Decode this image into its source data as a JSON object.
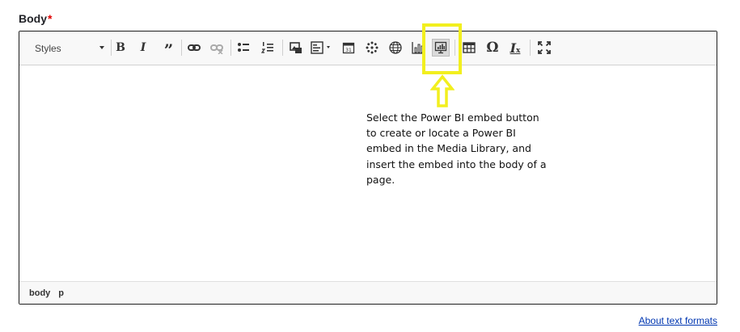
{
  "field": {
    "label": "Body",
    "required_marker": "*"
  },
  "toolbar": {
    "styles_label": "Styles",
    "bold_label": "B",
    "italic_label": "I",
    "quote_label": "”",
    "special_char_label": "Ω",
    "remove_format_label": "I",
    "icons": [
      "bold-icon",
      "italic-icon",
      "blockquote-icon",
      "link-icon",
      "unlink-icon",
      "bulleted-list-icon",
      "numbered-list-icon",
      "image-icon",
      "align-icon",
      "calendar-icon",
      "spark-icon",
      "globe-icon",
      "chart-icon",
      "power-bi-embed-icon",
      "table-icon",
      "special-character-icon",
      "remove-format-icon",
      "maximize-icon"
    ]
  },
  "annotation": {
    "lines": [
      "Select the Power BI embed button",
      "to create or locate a Power BI",
      "embed in the Media Library, and",
      "insert the embed into the body of a",
      "page."
    ]
  },
  "statusbar": {
    "path": [
      "body",
      "p"
    ]
  },
  "help_link": "About text formats",
  "colors": {
    "highlight": "#f2ef1e",
    "required": "#e00000",
    "link": "#0036b1"
  }
}
